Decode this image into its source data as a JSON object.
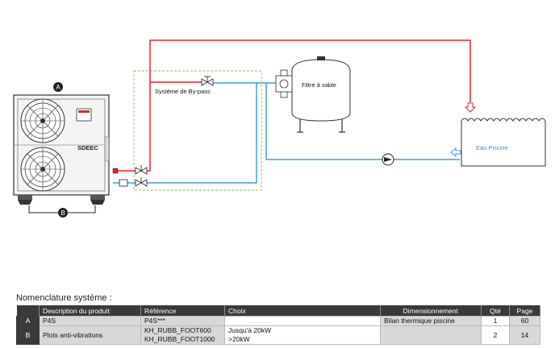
{
  "diagram": {
    "marker_a": "A",
    "marker_b": "B",
    "brand": "SDEEC",
    "bypass_label": "Système de By-pass",
    "filter_label": "Filtre à sable",
    "pool_label": "Eau Piscine"
  },
  "colors": {
    "hot_pipe": "#e4252d",
    "cold_pipe": "#3aa0d7",
    "bypass_frame": "#8cc063",
    "table_header": "#3a3a3c",
    "table_shade": "#d8d8d9"
  },
  "nomenclature": {
    "title": "Nomenclature système :",
    "headers": {
      "description": "Description du produit",
      "reference": "Référence",
      "choix": "Choix",
      "dimensionnement": "Dimensionnement",
      "qte": "Qté",
      "page": "Page"
    },
    "rows": [
      {
        "letter": "A",
        "description": "P4S",
        "reference_1": "P4S***",
        "reference_2": "",
        "choix_1": "",
        "choix_2": "",
        "dimensionnement": "Bilan thermique piscine",
        "qte": "1",
        "page": "60"
      },
      {
        "letter": "B",
        "description": "Plots anti-vibrations",
        "reference_1": "KH_RUBB_FOOT600",
        "reference_2": "KH_RUBB_FOOT1000",
        "choix_1": "Jusqu'à 20kW",
        "choix_2": ">20kW",
        "dimensionnement": "",
        "qte": "2",
        "page": "14"
      }
    ]
  }
}
